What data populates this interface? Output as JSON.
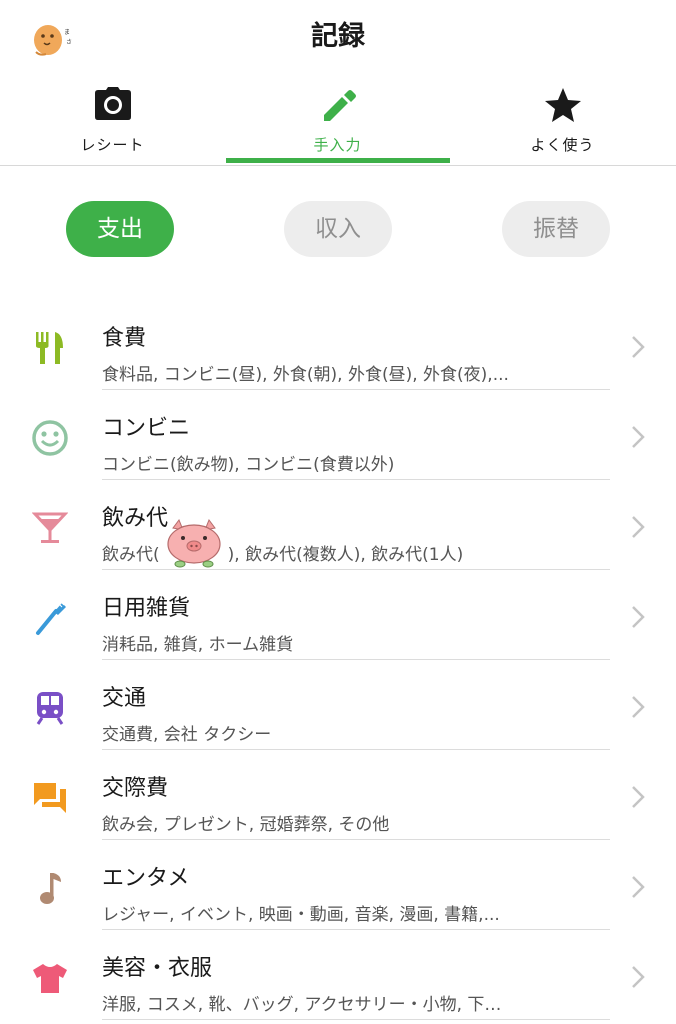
{
  "header": {
    "title": "記録"
  },
  "tabs": [
    {
      "label": "レシート",
      "icon": "camera-icon"
    },
    {
      "label": "手入力",
      "icon": "pencil-icon"
    },
    {
      "label": "よく使う",
      "icon": "star-icon"
    }
  ],
  "segments": [
    {
      "label": "支出"
    },
    {
      "label": "収入"
    },
    {
      "label": "振替"
    }
  ],
  "categories": [
    {
      "name": "食費",
      "sub": "食料品, コンビニ(昼), 外食(朝), 外食(昼), 外食(夜),...",
      "icon": "cutlery-icon",
      "color": "#8dba24"
    },
    {
      "name": "コンビニ",
      "sub": "コンビニ(飲み物), コンビニ(食費以外)",
      "icon": "smiley-icon",
      "color": "#8fc4a2"
    },
    {
      "name": "飲み代",
      "sub": "飲み代(　　　　), 飲み代(複数人), 飲み代(1人)",
      "icon": "cocktail-glass-icon",
      "color": "#e58a9a"
    },
    {
      "name": "日用雑貨",
      "sub": "消耗品, 雑貨, ホーム雑貨",
      "icon": "toothbrush-icon",
      "color": "#3a9ad9"
    },
    {
      "name": "交通",
      "sub": "交通費, 会社 タクシー",
      "icon": "train-icon",
      "color": "#7a4fc6"
    },
    {
      "name": "交際費",
      "sub": "飲み会, プレゼント, 冠婚葬祭, その他",
      "icon": "chat-bubbles-icon",
      "color": "#f29a1f"
    },
    {
      "name": "エンタメ",
      "sub": "レジャー, イベント, 映画・動画, 音楽, 漫画, 書籍,...",
      "icon": "music-note-icon",
      "color": "#b08a72"
    },
    {
      "name": "美容・衣服",
      "sub": "洋服, コスメ, 靴、バッグ, アクセサリー・小物, 下…",
      "icon": "tshirt-icon",
      "color": "#ee5a78"
    }
  ],
  "colors": {
    "accent": "#3eb049",
    "inactive_pill": "#ededed",
    "chevron": "#c4c4c4"
  }
}
